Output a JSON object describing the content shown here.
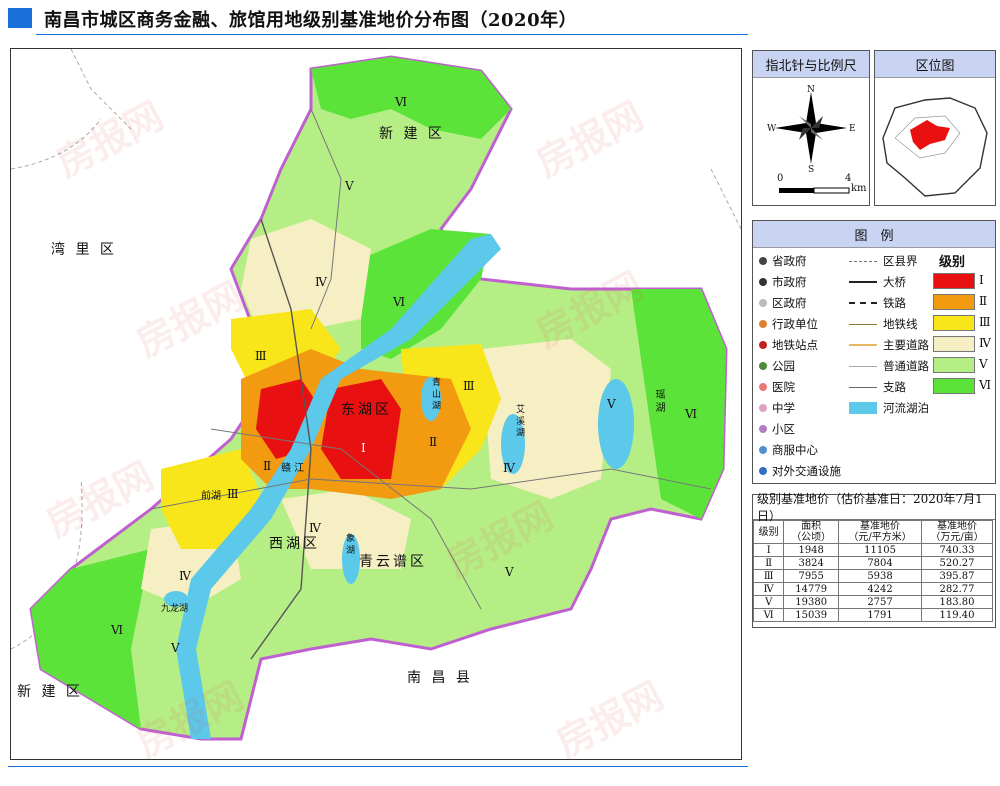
{
  "header": {
    "title": "南昌市城区商务金融、旅馆用地级别基准地价分布图（2020年）"
  },
  "colors": {
    "accent": "#1a6fd8",
    "level_I": "#e81010",
    "level_II": "#f29a10",
    "level_III": "#f8e61a",
    "level_IV": "#f6efc3",
    "level_V": "#b6ee86",
    "level_VI": "#5ce33a",
    "water": "#5cc8ea",
    "panel_head": "#c9d3f2"
  },
  "map": {
    "labels": {
      "xinjian_north": "新 建 区",
      "wanli": "湾 里 区",
      "donghu": "东湖区",
      "xihu": "西湖区",
      "qingyunpu": "青云谱区",
      "nanchang_county": "南 昌 县",
      "xinjian_south": "新 建 区",
      "ganjiang": "赣 江",
      "qianhu": "前湖",
      "jiulonghu": "九龙湖",
      "yaohu": "瑶 湖",
      "aixihu": "艾 溪 湖",
      "qingshanhu": "青 山 湖",
      "xianghu": "象 湖"
    },
    "level_marks": [
      "Ⅵ",
      "Ⅴ",
      "Ⅳ",
      "Ⅵ",
      "Ⅲ",
      "Ⅱ",
      "Ⅰ",
      "Ⅲ",
      "Ⅱ",
      "Ⅲ",
      "Ⅳ",
      "Ⅴ",
      "Ⅵ",
      "Ⅳ",
      "Ⅳ",
      "Ⅴ",
      "Ⅵ",
      "Ⅴ"
    ]
  },
  "compass": {
    "title": "指北针与比例尺",
    "n": "N",
    "s": "S",
    "e": "E",
    "w": "W",
    "scale_start": "0",
    "scale_end": "4",
    "scale_unit": "km"
  },
  "locator": {
    "title": "区位图"
  },
  "legend": {
    "title": "图　例",
    "symbols": [
      {
        "label": "省政府",
        "icon": "province-gov-icon",
        "color": "#444"
      },
      {
        "label": "市政府",
        "icon": "city-gov-icon",
        "color": "#333"
      },
      {
        "label": "区政府",
        "icon": "district-gov-icon",
        "color": "#bbb"
      },
      {
        "label": "行政单位",
        "icon": "admin-unit-icon",
        "color": "#e08030"
      },
      {
        "label": "地铁站点",
        "icon": "metro-station-icon",
        "color": "#c02020"
      },
      {
        "label": "公园",
        "icon": "park-icon",
        "color": "#4a8a3a"
      },
      {
        "label": "医院",
        "icon": "hospital-icon",
        "color": "#e87a7a"
      },
      {
        "label": "中学",
        "icon": "school-icon",
        "color": "#e0a0c0"
      },
      {
        "label": "小区",
        "icon": "residential-icon",
        "color": "#b080c0"
      },
      {
        "label": "商服中心",
        "icon": "commerce-center-icon",
        "color": "#5090d0"
      },
      {
        "label": "对外交通设施",
        "icon": "transport-icon",
        "color": "#3070c0"
      }
    ],
    "lines": [
      {
        "label": "区县界",
        "icon": "county-border-icon"
      },
      {
        "label": "大桥",
        "icon": "bridge-icon"
      },
      {
        "label": "铁路",
        "icon": "railway-icon"
      },
      {
        "label": "地铁线",
        "icon": "metro-line-icon"
      },
      {
        "label": "主要道路",
        "icon": "main-road-icon"
      },
      {
        "label": "普通道路",
        "icon": "normal-road-icon"
      },
      {
        "label": "支路",
        "icon": "branch-road-icon"
      },
      {
        "label": "河流湖泊",
        "icon": "water-icon"
      }
    ],
    "levels_title": "级别",
    "levels": [
      "Ⅰ",
      "Ⅱ",
      "Ⅲ",
      "Ⅳ",
      "Ⅴ",
      "Ⅵ"
    ]
  },
  "price_table": {
    "title": "级别基准地价（估价基准日：2020年7月1日）",
    "headers": [
      "级别",
      "面积\n（公顷）",
      "基准地价\n（元/平方米）",
      "基准地价\n（万元/亩）"
    ],
    "rows": [
      [
        "Ⅰ",
        "1948",
        "11105",
        "740.33"
      ],
      [
        "Ⅱ",
        "3824",
        "7804",
        "520.27"
      ],
      [
        "Ⅲ",
        "7955",
        "5938",
        "395.87"
      ],
      [
        "Ⅳ",
        "14779",
        "4242",
        "282.77"
      ],
      [
        "Ⅴ",
        "19380",
        "2757",
        "183.80"
      ],
      [
        "Ⅵ",
        "15039",
        "1791",
        "119.40"
      ]
    ]
  }
}
